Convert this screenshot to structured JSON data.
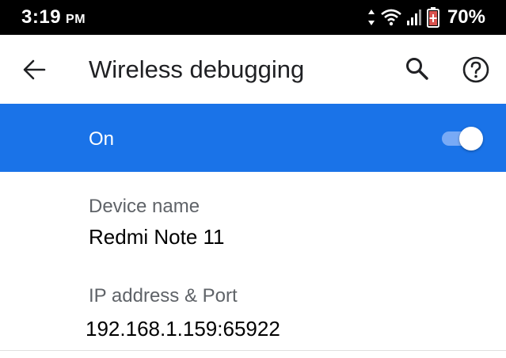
{
  "status_bar": {
    "time": "3:19",
    "ampm": "PM",
    "battery_percent": "70%",
    "icons": [
      "data-arrows-icon",
      "wifi-icon",
      "signal-icon",
      "battery-charging-icon"
    ]
  },
  "app_bar": {
    "title": "Wireless debugging",
    "icons": [
      "back-arrow-icon",
      "search-icon",
      "help-icon"
    ]
  },
  "main_switch": {
    "label": "On",
    "state": true,
    "bar_color": "#1a73e8"
  },
  "preferences": [
    {
      "title": "Device name",
      "summary": "Redmi Note 11"
    },
    {
      "title": "IP address & Port",
      "summary": "192.168.1.159:65922"
    }
  ]
}
